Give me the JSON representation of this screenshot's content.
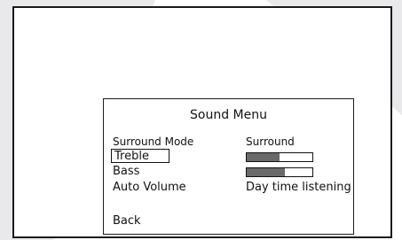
{
  "menu": {
    "title": "Sound Menu",
    "items": [
      {
        "label": "Surround Mode",
        "value": "Surround"
      },
      {
        "label": "Treble",
        "level": 0.5,
        "selected": true
      },
      {
        "label": "Bass",
        "level": 0.58
      },
      {
        "label": "Auto Volume",
        "value": "Day time listening"
      }
    ],
    "back_label": "Back"
  },
  "colors": {
    "frame": "#1a1a1a",
    "bar_fill": "#6a6a6a"
  }
}
